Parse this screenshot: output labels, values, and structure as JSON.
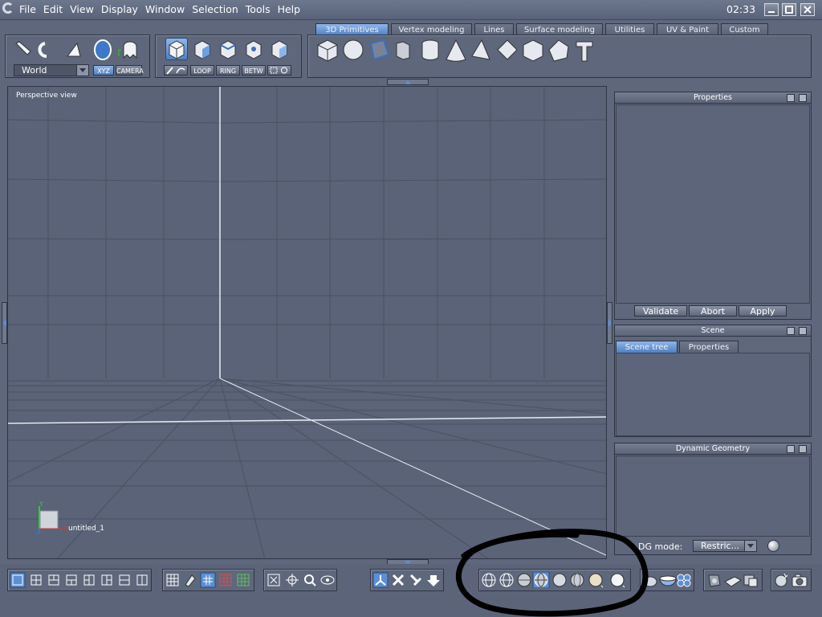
{
  "menubar": {
    "items": [
      "File",
      "Edit",
      "View",
      "Display",
      "Window",
      "Selection",
      "Tools",
      "Help"
    ],
    "clock": "02:33"
  },
  "toolbar_left": {
    "coordinate_system": "World",
    "xyz_label": "XYZ",
    "camera_label": "CAMERA"
  },
  "toolbar_mid": {
    "buttons": [
      "LOOP",
      "RING",
      "BETW"
    ]
  },
  "tabs": [
    "3D Primitives",
    "Vertex modeling",
    "Lines",
    "Surface modeling",
    "Utilities",
    "UV & Paint",
    "Custom"
  ],
  "viewport": {
    "label": "Perspective view",
    "object_name": "untitled_1",
    "axis_x": "X",
    "axis_y": "Y",
    "axis_z": "Z"
  },
  "properties_panel": {
    "title": "Properties",
    "buttons": [
      "Validate",
      "Abort",
      "Apply"
    ]
  },
  "scene_panel": {
    "title": "Scene",
    "tabs": [
      "Scene tree",
      "Properties"
    ]
  },
  "dynamic_panel": {
    "title": "Dynamic Geometry",
    "mode_label": "DG mode:",
    "mode_value": "Restric..."
  },
  "colors": {
    "accent": "#5b8fd6",
    "background": "#5e677b",
    "annotation": "#000000"
  }
}
